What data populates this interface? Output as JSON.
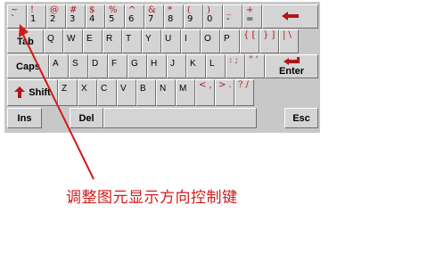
{
  "row1": [
    {
      "top": "~",
      "bot": "`"
    },
    {
      "top": "!",
      "bot": "1"
    },
    {
      "top": "@",
      "bot": "2"
    },
    {
      "top": "#",
      "bot": "3"
    },
    {
      "top": "$",
      "bot": "4"
    },
    {
      "top": "%",
      "bot": "5"
    },
    {
      "top": "^",
      "bot": "6"
    },
    {
      "top": "&",
      "bot": "7"
    },
    {
      "top": "*",
      "bot": "8"
    },
    {
      "top": "(",
      "bot": "9"
    },
    {
      "top": ")",
      "bot": "0"
    },
    {
      "top": "_",
      "bot": "-"
    },
    {
      "top": "+",
      "bot": "="
    }
  ],
  "row2": [
    "Q",
    "W",
    "E",
    "R",
    "T",
    "Y",
    "U",
    "I",
    "O",
    "P",
    "{ [",
    "} ]",
    "| \\"
  ],
  "row3": [
    "A",
    "S",
    "D",
    "F",
    "G",
    "H",
    "J",
    "K",
    "L",
    ": ;",
    "\" '"
  ],
  "row4": [
    "Z",
    "X",
    "C",
    "V",
    "B",
    "N",
    "M",
    "< ,",
    "> .",
    "? /"
  ],
  "labels": {
    "tab": "Tab",
    "caps": "Caps",
    "shift": "Shift",
    "enter": "Enter",
    "ins": "Ins",
    "del": "Del",
    "esc": "Esc",
    "backspace_icon": "left-arrow-icon",
    "enter_icon": "return-arrow-icon",
    "shift_icon": "up-arrow-icon"
  },
  "annotation": "调整图元显示方向控制键",
  "colors": {
    "accent": "#b0161b",
    "annotation": "#d31a1a"
  }
}
